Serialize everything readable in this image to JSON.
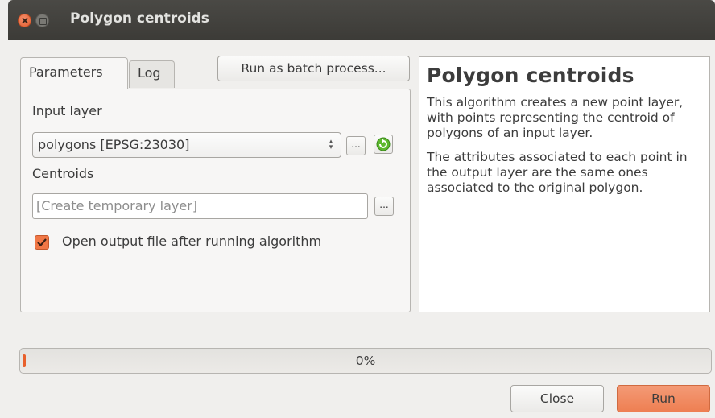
{
  "window": {
    "title": "Polygon centroids"
  },
  "tabs": [
    {
      "label": "Parameters",
      "active": true
    },
    {
      "label": "Log",
      "active": false
    }
  ],
  "toolbar": {
    "batch_label": "Run as batch process..."
  },
  "params": {
    "input_layer_label": "Input layer",
    "input_layer_value": "polygons [EPSG:23030]",
    "ellipsis": "...",
    "centroids_label": "Centroids",
    "centroids_placeholder": "[Create temporary layer]",
    "open_output_label": "Open output file after running algorithm",
    "open_output_checked": true
  },
  "help": {
    "title": "Polygon centroids",
    "paragraph1": "This algorithm creates a new point layer, with points representing the centroid of polygons of an input layer.",
    "paragraph2": "The attributes associated to each point in the output layer are the same ones associated to the original polygon."
  },
  "progress": {
    "value": 0,
    "text": "0%"
  },
  "buttons": {
    "close_mnemonic": "C",
    "close_rest": "lose",
    "run": "Run"
  },
  "colors": {
    "accent": "#f07746",
    "run_button": "#ee7f52",
    "titlebar": "#3c3b37"
  },
  "icons": {
    "close": "close-icon",
    "minimize": "minimize-icon",
    "refresh": "refresh-icon",
    "checkbox": "check-icon",
    "combo": "spinner-arrows-icon"
  }
}
